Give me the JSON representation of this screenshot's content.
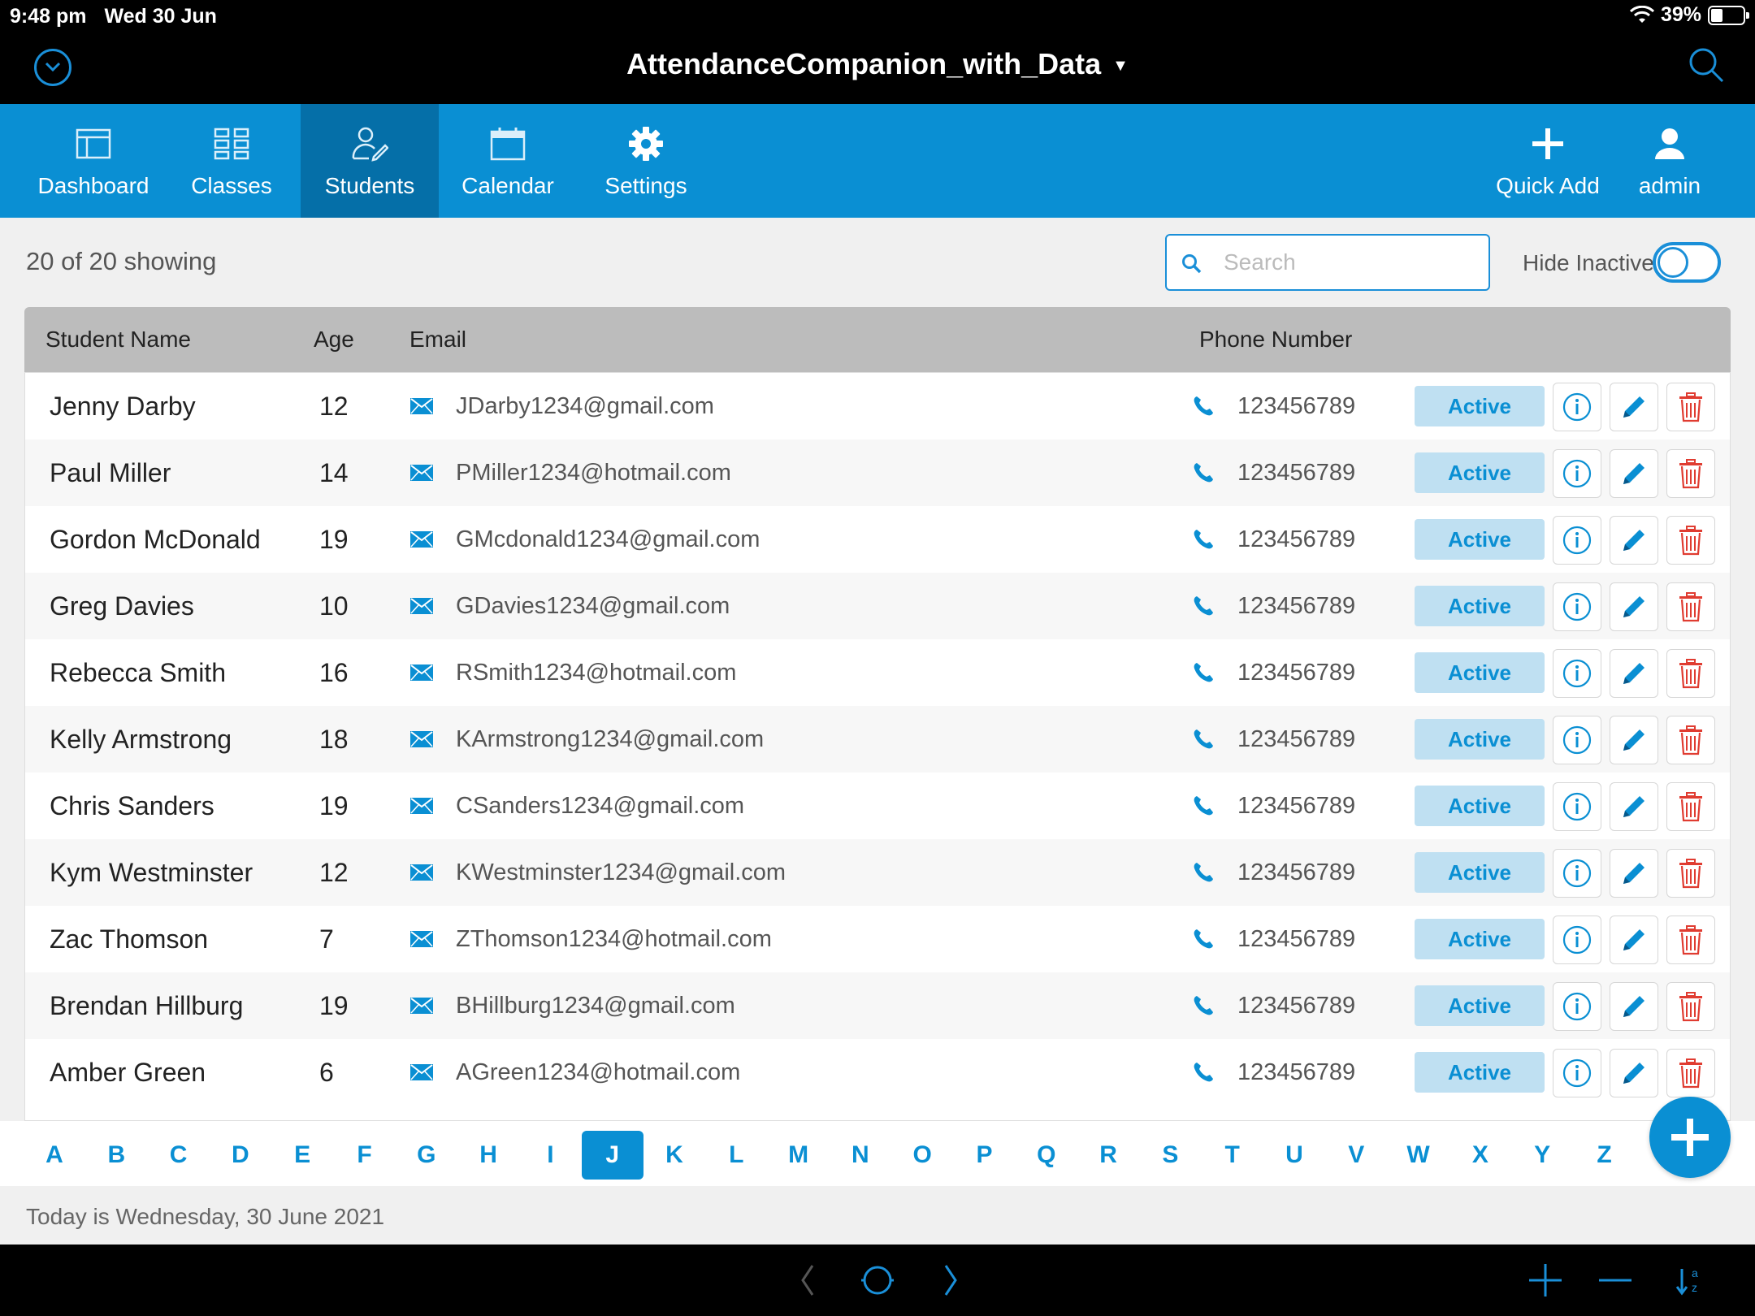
{
  "status_bar": {
    "time": "9:48 pm",
    "date": "Wed 30 Jun",
    "battery": "39%"
  },
  "app": {
    "title": "AttendanceCompanion_with_Data"
  },
  "nav": {
    "items": [
      {
        "label": "Dashboard",
        "icon": "dashboard-icon"
      },
      {
        "label": "Classes",
        "icon": "grid-icon"
      },
      {
        "label": "Students",
        "icon": "student-icon",
        "active": true
      },
      {
        "label": "Calendar",
        "icon": "calendar-icon"
      },
      {
        "label": "Settings",
        "icon": "gear-icon"
      }
    ],
    "quick_add": "Quick Add",
    "user": "admin"
  },
  "toolbar": {
    "showing": "20 of 20 showing",
    "search_placeholder": "Search",
    "hide_inactive": "Hide Inactive",
    "hide_inactive_on": false
  },
  "table": {
    "headers": {
      "name": "Student Name",
      "age": "Age",
      "email": "Email",
      "phone": "Phone Number"
    },
    "rows": [
      {
        "name": "Jenny Darby",
        "age": "12",
        "email": "JDarby1234@gmail.com",
        "phone": "123456789",
        "status": "Active"
      },
      {
        "name": "Paul Miller",
        "age": "14",
        "email": "PMiller1234@hotmail.com",
        "phone": "123456789",
        "status": "Active"
      },
      {
        "name": "Gordon McDonald",
        "age": "19",
        "email": "GMcdonald1234@gmail.com",
        "phone": "123456789",
        "status": "Active"
      },
      {
        "name": "Greg Davies",
        "age": "10",
        "email": "GDavies1234@gmail.com",
        "phone": "123456789",
        "status": "Active"
      },
      {
        "name": "Rebecca Smith",
        "age": "16",
        "email": "RSmith1234@hotmail.com",
        "phone": "123456789",
        "status": "Active"
      },
      {
        "name": "Kelly Armstrong",
        "age": "18",
        "email": "KArmstrong1234@gmail.com",
        "phone": "123456789",
        "status": "Active"
      },
      {
        "name": "Chris Sanders",
        "age": "19",
        "email": "CSanders1234@gmail.com",
        "phone": "123456789",
        "status": "Active"
      },
      {
        "name": "Kym Westminster",
        "age": "12",
        "email": "KWestminster1234@gmail.com",
        "phone": "123456789",
        "status": "Active"
      },
      {
        "name": "Zac Thomson",
        "age": "7",
        "email": "ZThomson1234@hotmail.com",
        "phone": "123456789",
        "status": "Active"
      },
      {
        "name": "Brendan Hillburg",
        "age": "19",
        "email": "BHillburg1234@gmail.com",
        "phone": "123456789",
        "status": "Active"
      },
      {
        "name": "Amber Green",
        "age": "6",
        "email": "AGreen1234@hotmail.com",
        "phone": "123456789",
        "status": "Active"
      }
    ]
  },
  "alphabet": {
    "letters": [
      "A",
      "B",
      "C",
      "D",
      "E",
      "F",
      "G",
      "H",
      "I",
      "J",
      "K",
      "L",
      "M",
      "N",
      "O",
      "P",
      "Q",
      "R",
      "S",
      "T",
      "U",
      "V",
      "W",
      "X",
      "Y",
      "Z"
    ],
    "selected": "J"
  },
  "footer": {
    "today": "Today is Wednesday, 30 June 2021"
  },
  "colors": {
    "accent": "#0a8fd3",
    "active_nav": "#056fa8",
    "status_bg": "#bfe0f2",
    "delete": "#e03c31"
  }
}
